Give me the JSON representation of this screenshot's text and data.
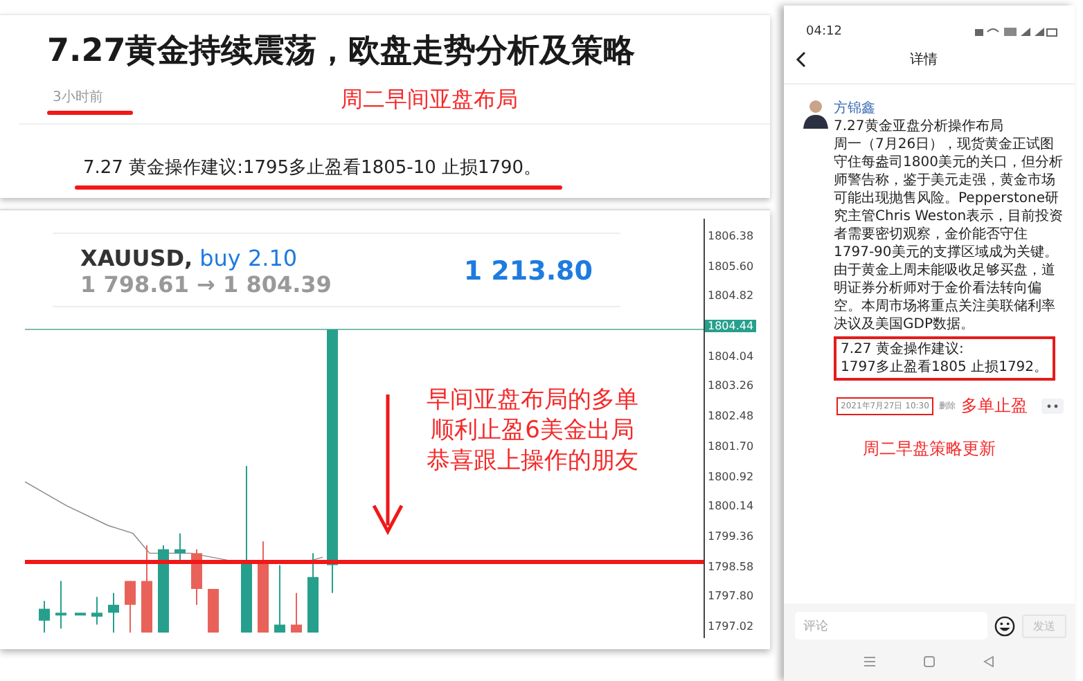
{
  "article": {
    "title": "7.27黄金持续震荡，欧盘走势分析及策略",
    "time": "3小时前",
    "note": "周二早间亚盘布局",
    "advice": "7.27 黄金操作建议:1795多止盈看1805-10 止损1790。"
  },
  "chart": {
    "symbol": "XAUUSD,",
    "order": "buy 2.10",
    "prices": "1 798.61 → 1 804.39",
    "profit": "1 213.80",
    "price_labels": [
      {
        "text": "1806.38",
        "highlighted": false
      },
      {
        "text": "1805.60",
        "highlighted": false
      },
      {
        "text": "1804.82",
        "highlighted": false
      },
      {
        "text": "1804.44",
        "highlighted": true
      },
      {
        "text": "1804.04",
        "highlighted": false
      },
      {
        "text": "1803.26",
        "highlighted": false
      },
      {
        "text": "1802.48",
        "highlighted": false
      },
      {
        "text": "1801.70",
        "highlighted": false
      },
      {
        "text": "1800.92",
        "highlighted": false
      },
      {
        "text": "1800.14",
        "highlighted": false
      },
      {
        "text": "1799.36",
        "highlighted": false
      },
      {
        "text": "1798.58",
        "highlighted": false
      },
      {
        "text": "1797.80",
        "highlighted": false
      },
      {
        "text": "1797.02",
        "highlighted": false
      }
    ],
    "note": [
      "早间亚盘布局的多单",
      "顺利止盈6美金出局",
      "恭喜跟上操作的朋友"
    ]
  },
  "phone": {
    "time": "04:12",
    "title": "详情",
    "post": {
      "author": "方锦鑫",
      "headline": "7.27黄金亚盘分析操作布局",
      "body": "周一（7月26日），现货黄金正试图守住每盎司1800美元的关口，但分析师警告称，鉴于美元走强，黄金市场可能出现抛售风险。Pepperstone研究主管Chris Weston表示，目前投资者需要密切观察，金价能否守住1797-90美元的支撑区域成为关键。由于黄金上周未能吸收足够买盘，道明证券分析师对于金价看法转向偏空。本周市场将重点关注美联储利率决议及美国GDP数据。",
      "advice": [
        "7.27 黄金操作建议:",
        "1797多止盈看1805  止损1792。"
      ],
      "timestamp": "2021年7月27日 10:30",
      "delete": "删除"
    },
    "notes": [
      "多单止盈",
      "周二早盘策略更新"
    ],
    "comment": {
      "placeholder": "评论",
      "send": "发送",
      "send_disabled": true
    }
  }
}
